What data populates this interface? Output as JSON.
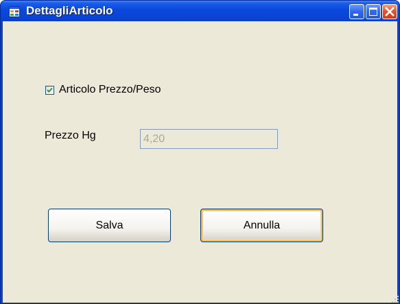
{
  "window": {
    "title": "DettagliArticolo"
  },
  "checkbox": {
    "label": "Articolo Prezzo/Peso",
    "checked": true
  },
  "price_field": {
    "label": "Prezzo Hg",
    "value": "4,20",
    "disabled": true
  },
  "buttons": {
    "save_label": "Salva",
    "cancel_label": "Annulla"
  },
  "icons": {
    "app": "form-icon",
    "minimize": "minimize-icon",
    "maximize": "maximize-icon",
    "close": "close-icon",
    "check": "checkmark-icon",
    "grip": "resize-grip-icon"
  },
  "colors": {
    "title_bar": "#0a46d6",
    "client_background": "#ece9d8",
    "close_button": "#d23c16",
    "check_mark": "#21a121",
    "default_button_focus": "#f8b84a"
  }
}
